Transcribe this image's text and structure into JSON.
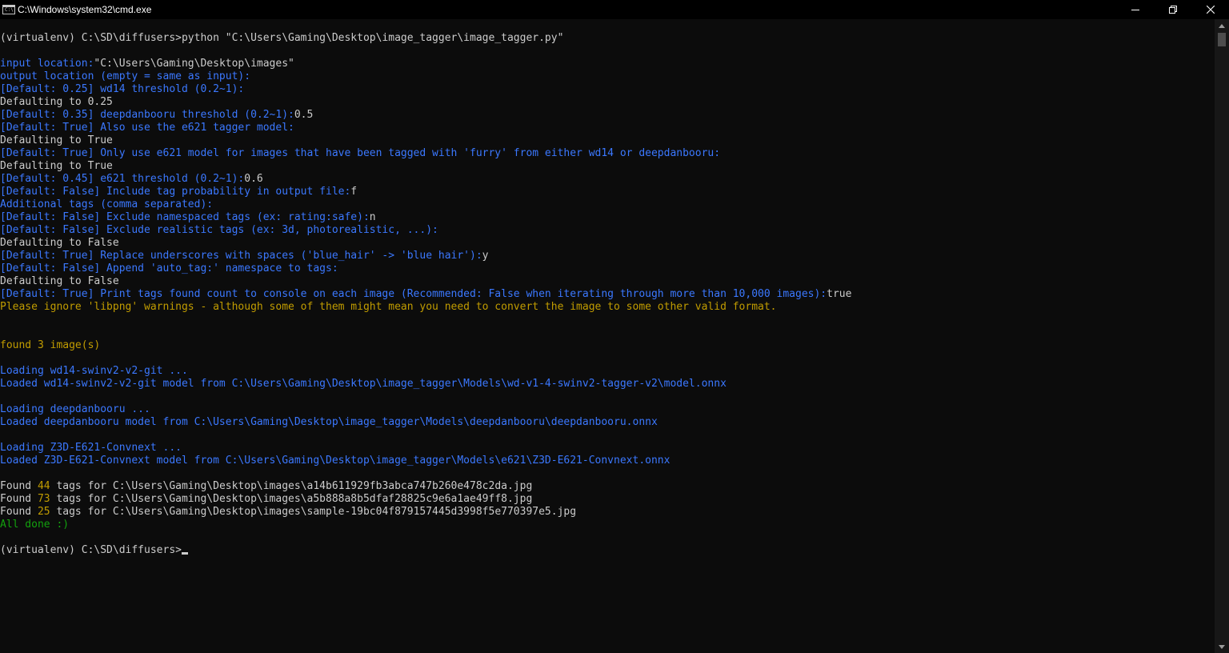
{
  "window": {
    "title": "C:\\Windows\\system32\\cmd.exe",
    "icon": "cmd-icon",
    "icon_text": "C:\\"
  },
  "colors": {
    "background": "#0c0c0c",
    "text": "#cccccc",
    "blue": "#3b78ff",
    "yellow": "#c19c00",
    "green": "#13a10e"
  },
  "console": {
    "lines": [
      [
        {
          "t": "(virtualenv) C:\\SD\\diffusers>python \"C:\\Users\\Gaming\\Desktop\\image_tagger\\image_tagger.py\"",
          "c": "white"
        }
      ],
      [],
      [
        {
          "t": "input location:",
          "c": "blue"
        },
        {
          "t": "\"C:\\Users\\Gaming\\Desktop\\images\"",
          "c": "white"
        }
      ],
      [
        {
          "t": "output location (empty = same as input):",
          "c": "blue"
        }
      ],
      [
        {
          "t": "[Default: 0.25] wd14 threshold (0.2~1):",
          "c": "blue"
        }
      ],
      [
        {
          "t": "Defaulting to 0.25",
          "c": "white"
        }
      ],
      [
        {
          "t": "[Default: 0.35] deepdanbooru threshold (0.2~1):",
          "c": "blue"
        },
        {
          "t": "0.5",
          "c": "white"
        }
      ],
      [
        {
          "t": "[Default: True] Also use the e621 tagger model:",
          "c": "blue"
        }
      ],
      [
        {
          "t": "Defaulting to True",
          "c": "white"
        }
      ],
      [
        {
          "t": "[Default: True] Only use e621 model for images that have been tagged with 'furry' from either wd14 or deepdanbooru:",
          "c": "blue"
        }
      ],
      [
        {
          "t": "Defaulting to True",
          "c": "white"
        }
      ],
      [
        {
          "t": "[Default: 0.45] e621 threshold (0.2~1):",
          "c": "blue"
        },
        {
          "t": "0.6",
          "c": "white"
        }
      ],
      [
        {
          "t": "[Default: False] Include tag probability in output file:",
          "c": "blue"
        },
        {
          "t": "f",
          "c": "white"
        }
      ],
      [
        {
          "t": "Additional tags (comma separated):",
          "c": "blue"
        }
      ],
      [
        {
          "t": "[Default: False] Exclude namespaced tags (ex: rating:safe):",
          "c": "blue"
        },
        {
          "t": "n",
          "c": "white"
        }
      ],
      [
        {
          "t": "[Default: False] Exclude realistic tags (ex: 3d, photorealistic, ...):",
          "c": "blue"
        }
      ],
      [
        {
          "t": "Defaulting to False",
          "c": "white"
        }
      ],
      [
        {
          "t": "[Default: True] Replace underscores with spaces ('blue_hair' -> 'blue hair'):",
          "c": "blue"
        },
        {
          "t": "y",
          "c": "white"
        }
      ],
      [
        {
          "t": "[Default: False] Append 'auto_tag:' namespace to tags:",
          "c": "blue"
        }
      ],
      [
        {
          "t": "Defaulting to False",
          "c": "white"
        }
      ],
      [
        {
          "t": "[Default: True] Print tags found count to console on each image (Recommended: False when iterating through more than 10,000 images):",
          "c": "blue"
        },
        {
          "t": "true",
          "c": "white"
        }
      ],
      [
        {
          "t": "Please ignore 'libpng' warnings - although some of them might mean you need to convert the image to some other valid format.",
          "c": "yellow"
        }
      ],
      [],
      [],
      [
        {
          "t": "found 3 image(s)",
          "c": "yellow"
        }
      ],
      [],
      [
        {
          "t": "Loading wd14-swinv2-v2-git ...",
          "c": "blue"
        }
      ],
      [
        {
          "t": "Loaded wd14-swinv2-v2-git model from C:\\Users\\Gaming\\Desktop\\image_tagger\\Models\\wd-v1-4-swinv2-tagger-v2\\model.onnx",
          "c": "blue"
        }
      ],
      [],
      [
        {
          "t": "Loading deepdanbooru ...",
          "c": "blue"
        }
      ],
      [
        {
          "t": "Loaded deepdanbooru model from C:\\Users\\Gaming\\Desktop\\image_tagger\\Models\\deepdanbooru\\deepdanbooru.onnx",
          "c": "blue"
        }
      ],
      [],
      [
        {
          "t": "Loading Z3D-E621-Convnext ...",
          "c": "blue"
        }
      ],
      [
        {
          "t": "Loaded Z3D-E621-Convnext model from C:\\Users\\Gaming\\Desktop\\image_tagger\\Models\\e621\\Z3D-E621-Convnext.onnx",
          "c": "blue"
        }
      ],
      [],
      [
        {
          "t": "Found ",
          "c": "white"
        },
        {
          "t": "44",
          "c": "yellow"
        },
        {
          "t": " tags for C:\\Users\\Gaming\\Desktop\\images\\a14b611929fb3abca747b260e478c2da.jpg",
          "c": "white"
        }
      ],
      [
        {
          "t": "Found ",
          "c": "white"
        },
        {
          "t": "73",
          "c": "yellow"
        },
        {
          "t": " tags for C:\\Users\\Gaming\\Desktop\\images\\a5b888a8b5dfaf28825c9e6a1ae49ff8.jpg",
          "c": "white"
        }
      ],
      [
        {
          "t": "Found ",
          "c": "white"
        },
        {
          "t": "25",
          "c": "yellow"
        },
        {
          "t": " tags for C:\\Users\\Gaming\\Desktop\\images\\sample-19bc04f879157445d3998f5e770397e5.jpg",
          "c": "white"
        }
      ],
      [
        {
          "t": "All done :)",
          "c": "green"
        }
      ],
      [],
      [
        {
          "t": "(virtualenv) C:\\SD\\diffusers>",
          "c": "white"
        },
        {
          "cursor": true
        }
      ]
    ]
  }
}
